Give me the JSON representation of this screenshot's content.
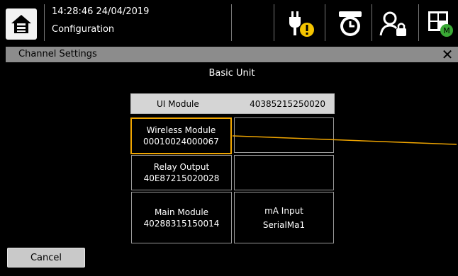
{
  "header": {
    "datetime": "14:28:46  24/04/2019",
    "mode": "Configuration",
    "icons": [
      "home-icon",
      "power-warning-icon",
      "timer-icon",
      "user-lock-icon",
      "modules-icon"
    ]
  },
  "dialog": {
    "title": "Channel Settings",
    "close_label": "✕"
  },
  "unit": {
    "title": "Basic Unit",
    "ui_module": {
      "label": "UI Module",
      "serial": "40385215250020"
    },
    "slots": [
      {
        "label": "Wireless Module",
        "value": "00010024000067",
        "selected": true
      },
      {
        "label": "",
        "value": ""
      },
      {
        "label": "Relay Output",
        "value": "40E87215020028"
      },
      {
        "label": "",
        "value": ""
      },
      {
        "label": "Main Module",
        "value": "40288315150014"
      },
      {
        "label": "mA Input",
        "value": "SerialMa1"
      }
    ]
  },
  "buttons": {
    "cancel": "Cancel"
  },
  "colors": {
    "selection": "#f0a500",
    "panel_gray": "#8c8c8c"
  }
}
